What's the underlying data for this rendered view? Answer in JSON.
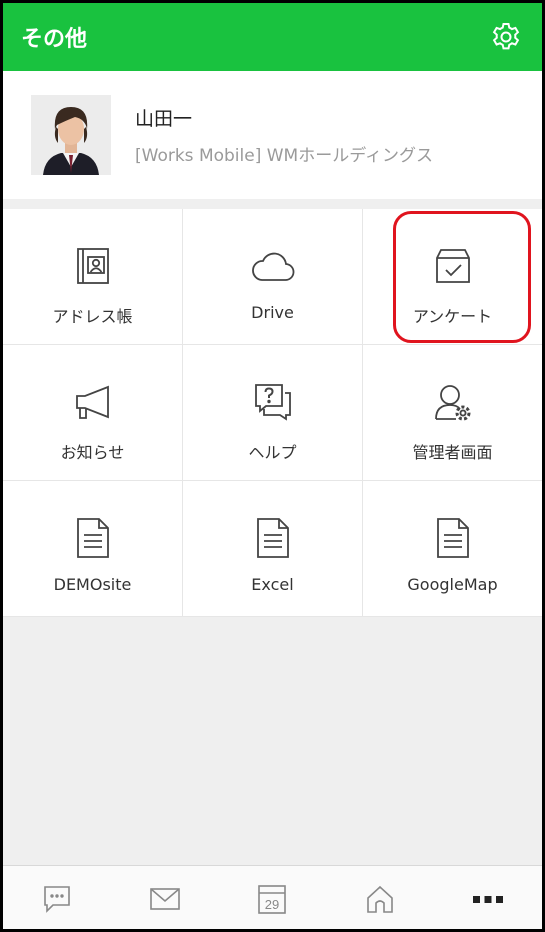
{
  "header": {
    "title": "その他",
    "settings_icon": "gear-icon"
  },
  "profile": {
    "name": "山田一",
    "organization": "[Works Mobile] WMホールディングス"
  },
  "grid": [
    {
      "label": "アドレス帳",
      "icon": "address-book-icon"
    },
    {
      "label": "Drive",
      "icon": "cloud-icon"
    },
    {
      "label": "アンケート",
      "icon": "survey-box-icon"
    },
    {
      "label": "お知らせ",
      "icon": "megaphone-icon"
    },
    {
      "label": "ヘルプ",
      "icon": "help-icon"
    },
    {
      "label": "管理者画面",
      "icon": "admin-icon"
    },
    {
      "label": "DEMOsite",
      "icon": "document-icon"
    },
    {
      "label": "Excel",
      "icon": "document-icon"
    },
    {
      "label": "GoogleMap",
      "icon": "document-icon"
    }
  ],
  "bottom_nav": {
    "items": [
      "chat-icon",
      "mail-icon",
      "calendar-icon",
      "home-icon",
      "more-icon"
    ],
    "calendar_day": "29"
  },
  "colors": {
    "header_bg": "#19c23f",
    "highlight": "#e0141e",
    "icon_stroke": "#444444"
  }
}
